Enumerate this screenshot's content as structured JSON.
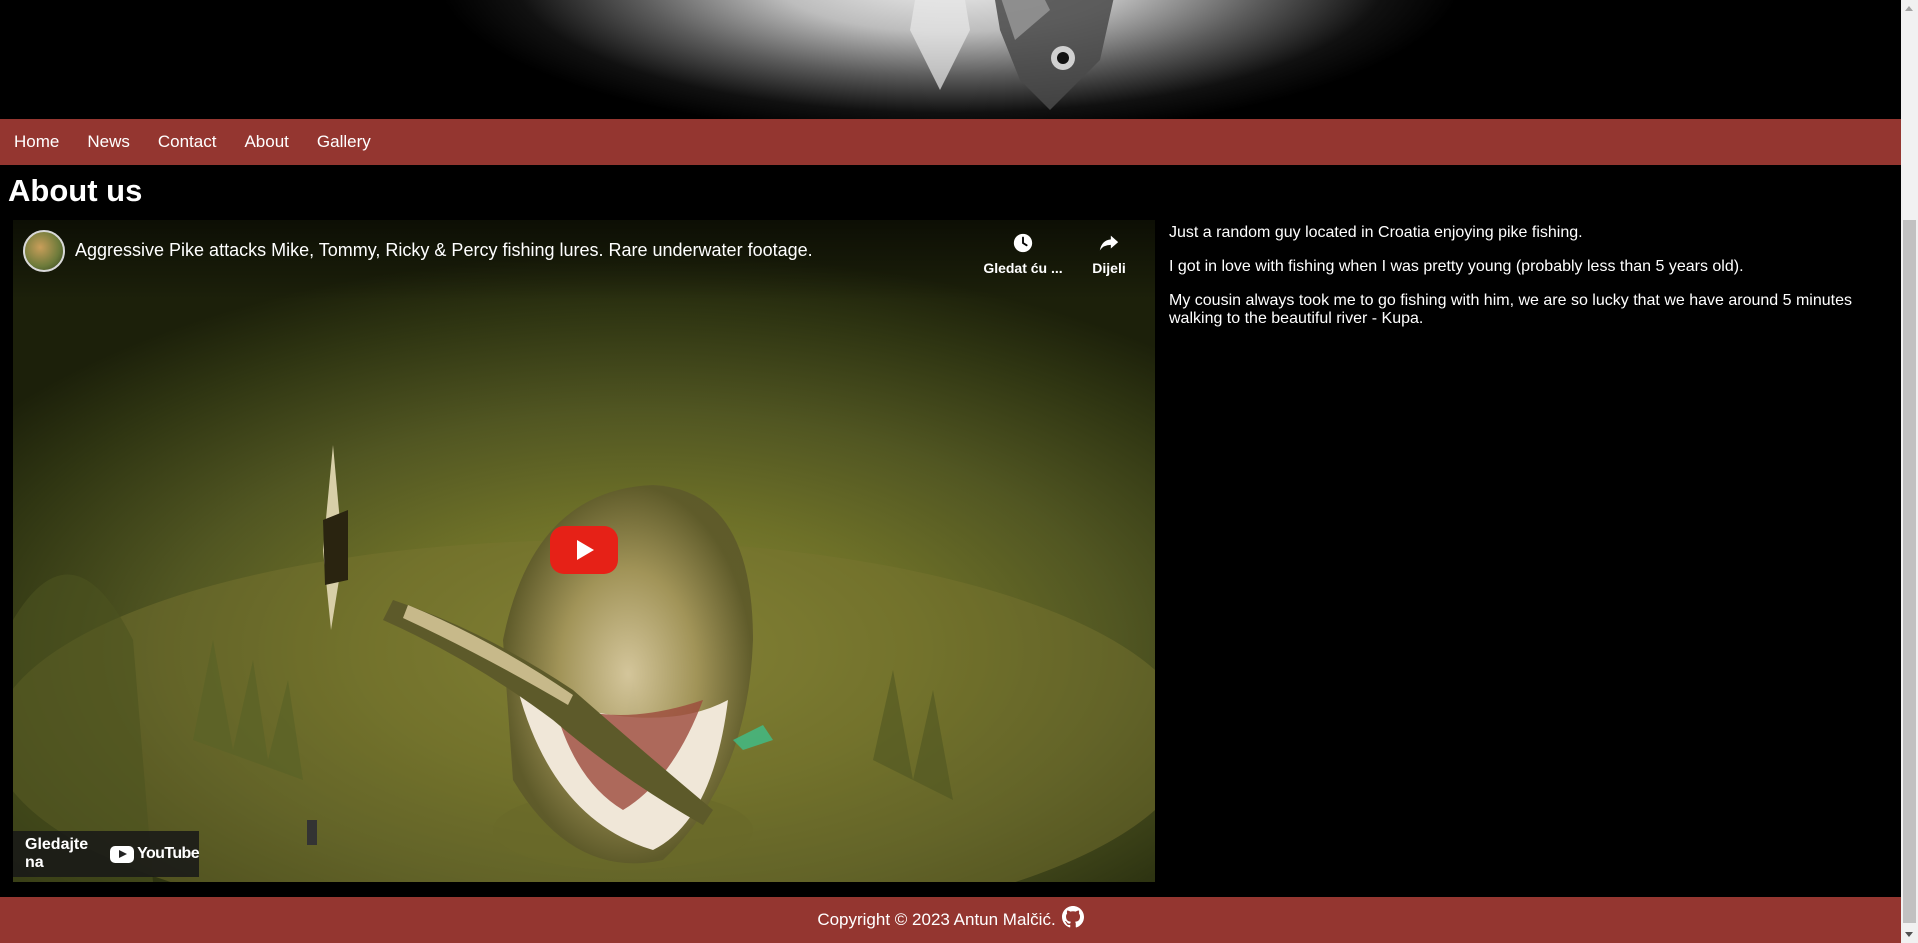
{
  "nav": {
    "items": [
      {
        "label": "Home"
      },
      {
        "label": "News"
      },
      {
        "label": "Contact"
      },
      {
        "label": "About"
      },
      {
        "label": "Gallery"
      }
    ]
  },
  "page": {
    "title": "About us"
  },
  "video": {
    "title": "Aggressive Pike attacks Mike, Tommy, Ricky & Percy fishing lures. Rare underwater footage.",
    "watch_later_label": "Gledat ću ...",
    "share_label": "Dijeli",
    "watch_on_label": "Gledajte na",
    "youtube_logo_text": "YouTube"
  },
  "about": {
    "paragraphs": [
      "Just a random guy located in Croatia enjoying pike fishing.",
      "I got in love with fishing when I was pretty young (probably less than 5 years old).",
      "My cousin always took me to go fishing with him, we are so lucky that we have around 5 minutes walking to the beautiful river - Kupa."
    ]
  },
  "footer": {
    "copyright": "Copyright © 2023 Antun Malčić."
  },
  "colors": {
    "accent": "#943630",
    "background": "#000000",
    "play_red": "#e62117"
  },
  "icons": {
    "watch_later": "clock-icon",
    "share": "share-arrow-icon",
    "play": "play-icon",
    "footer_link": "github-icon"
  }
}
